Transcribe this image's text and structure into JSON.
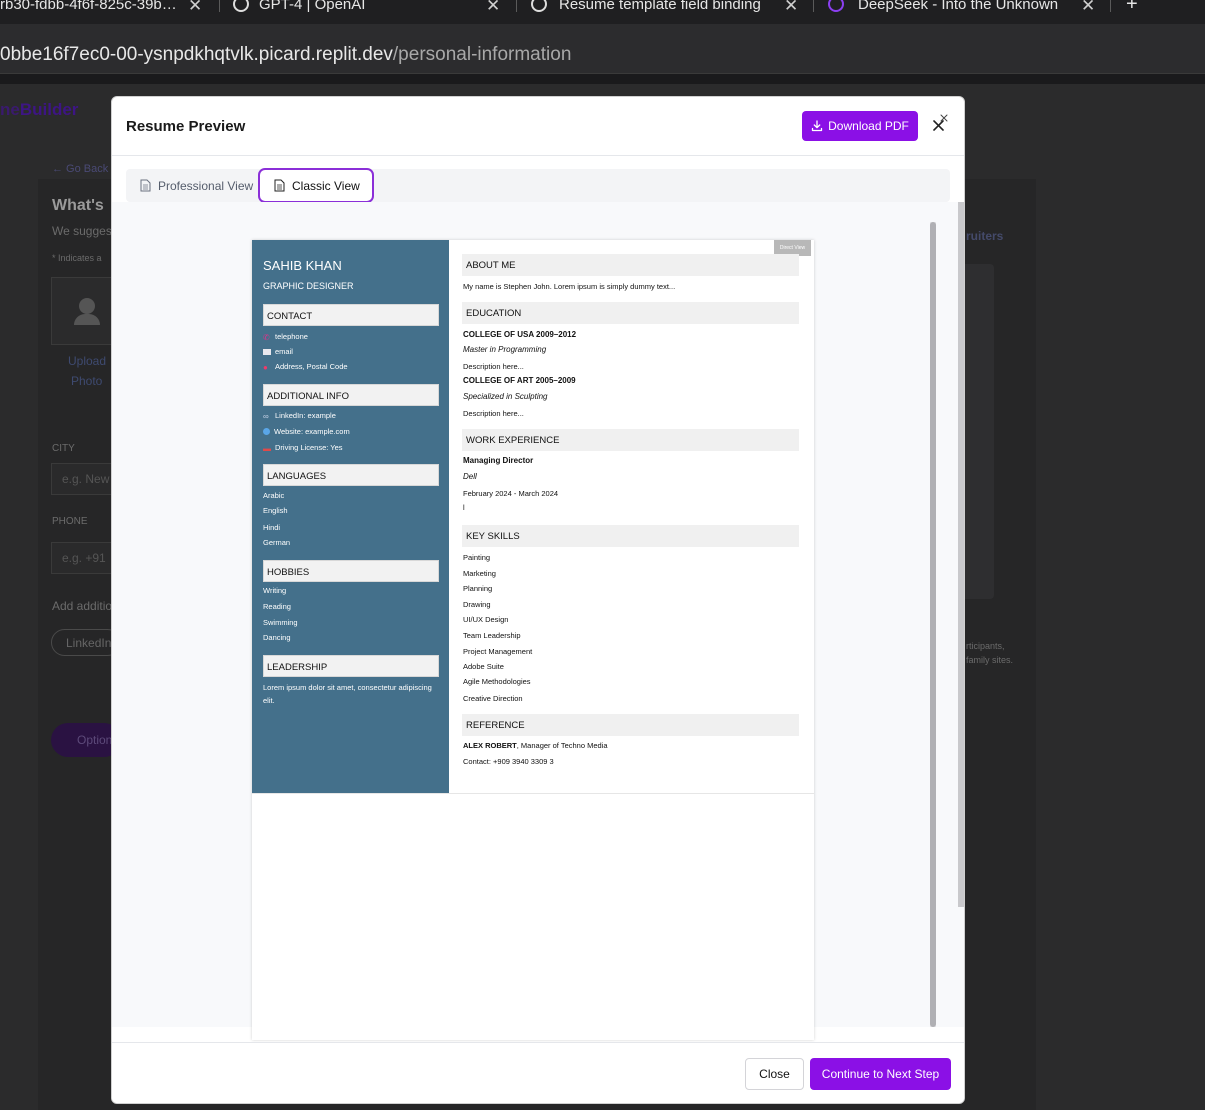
{
  "browser": {
    "tabs": [
      {
        "title": "rb30-fdbb-4f6f-825c-39b…",
        "icon": "replit-icon"
      },
      {
        "title": "GPT-4 | OpenAI",
        "icon": "openai-icon"
      },
      {
        "title": "Resume template field binding",
        "icon": "openai-icon"
      },
      {
        "title": "DeepSeek - Into the Unknown",
        "icon": "deepseek-icon"
      }
    ],
    "new_tab": "+",
    "url_host": "0bbe16f7ec0-00-ysnpdkhqtvlk.picard.replit.dev",
    "url_path": "/personal-information"
  },
  "background_app": {
    "brand_prefix": "ne",
    "brand_suffix": "Builder",
    "go_back": "← Go Back",
    "heading": "What's",
    "subtext": "We sugges",
    "required_note": "* Indicates a",
    "upload_line1": "Upload",
    "upload_line2": "Photo",
    "city_label": "CITY",
    "city_placeholder": "e.g. New",
    "phone_label": "PHONE",
    "phone_placeholder": "e.g. +91",
    "additional_label": "Add additio",
    "linkedin_pill": "LinkedIn",
    "options_button": "Option",
    "recruiters_text": "ruiters",
    "side_note1": "rticipants,",
    "side_note2": "family sites."
  },
  "modal": {
    "title": "Resume Preview",
    "download_label": "Download PDF",
    "close_x_label": "×",
    "tabs": [
      {
        "label": "Professional View",
        "active": false
      },
      {
        "label": "Classic View",
        "active": true
      }
    ],
    "footer": {
      "close_label": "Close",
      "next_label": "Continue to Next Step"
    },
    "accent_color": "#8b10e6"
  },
  "resume": {
    "name": "SAHIB KHAN",
    "job_title": "GRAPHIC DESIGNER",
    "direct_view": "Direct View",
    "sidebar_color": "#44708b",
    "contact_heading": "CONTACT",
    "contact": [
      {
        "icon": "phone-icon",
        "text": "telephone"
      },
      {
        "icon": "mail-icon",
        "text": "email"
      },
      {
        "icon": "location-pin-icon",
        "text": "Address, Postal Code"
      }
    ],
    "additional_heading": "ADDITIONAL INFO",
    "additional": [
      {
        "icon": "link-icon",
        "text": "LinkedIn: example"
      },
      {
        "icon": "globe-icon",
        "text": "Website: example.com"
      },
      {
        "icon": "car-icon",
        "text": "Driving License: Yes"
      }
    ],
    "languages_heading": "LANGUAGES",
    "languages": [
      "Arabic",
      "English",
      "Hindi",
      "German"
    ],
    "hobbies_heading": "HOBBIES",
    "hobbies": [
      "Writing",
      "Reading",
      "Swimming",
      "Dancing"
    ],
    "leadership_heading": "LEADERSHIP",
    "leadership_text": "Lorem ipsum dolor sit amet, consectetur adipiscing elit.",
    "about_heading": "ABOUT ME",
    "about_text": "My name is Stephen John. Lorem ipsum is simply dummy text...",
    "education_heading": "EDUCATION",
    "education": [
      {
        "school": "COLLEGE OF USA 2009–2012",
        "degree": "Master in Programming",
        "desc": "Description here..."
      },
      {
        "school": "COLLEGE OF ART 2005–2009",
        "degree": "Specialized in Sculpting",
        "desc": "Description here..."
      }
    ],
    "work_heading": "WORK EXPERIENCE",
    "work": {
      "role": "Managing Director",
      "company": "Dell",
      "dates": "February 2024 - March 2024",
      "detail": "l"
    },
    "skills_heading": "KEY SKILLS",
    "skills": [
      "Painting",
      "Marketing",
      "Planning",
      "Drawing",
      "UI/UX Design",
      "Team Leadership",
      "Project Management",
      "Adobe Suite",
      "Agile Methodologies",
      "Creative Direction"
    ],
    "reference_heading": "REFERENCE",
    "reference_name": "ALEX ROBERT",
    "reference_role": ", Manager of Techno Media",
    "reference_contact": "Contact: +909 3940 3309 3"
  }
}
